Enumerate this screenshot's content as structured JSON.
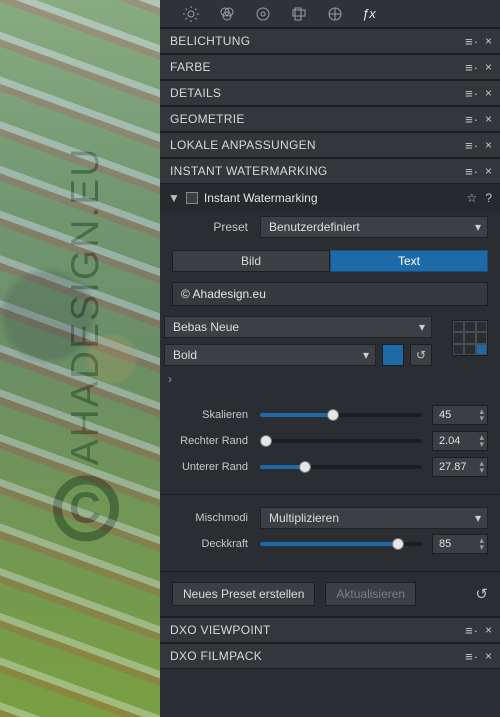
{
  "watermark_label": "AHADESIGN.EU",
  "tabs": [
    "brightness",
    "color-circles",
    "balance",
    "crop",
    "histogram",
    "fx"
  ],
  "sections": {
    "belichtung": "BELICHTUNG",
    "farbe": "FARBE",
    "details": "DETAILS",
    "geometrie": "GEOMETRIE",
    "lokal": "LOKALE ANPASSUNGEN",
    "watermark": "INSTANT WATERMARKING",
    "viewpoint": "DXO VIEWPOINT",
    "filmpack": "DXO FILMPACK"
  },
  "wm": {
    "title": "Instant Watermarking",
    "preset_label": "Preset",
    "preset_value": "Benutzerdefiniert",
    "bild": "Bild",
    "text": "Text",
    "input_value": "© Ahadesign.eu",
    "font": "Bebas Neue",
    "weight": "Bold",
    "swatch_color": "#1e6aa8",
    "skalieren_label": "Skalieren",
    "skalieren_value": "45",
    "rechter_label": "Rechter Rand",
    "rechter_value": "2.04",
    "unterer_label": "Unterer Rand",
    "unterer_value": "27.87",
    "mischmodi_label": "Mischmodi",
    "mischmodi_value": "Multiplizieren",
    "deckkraft_label": "Deckkraft",
    "deckkraft_value": "85",
    "neues_preset": "Neues Preset erstellen",
    "aktualisieren": "Aktualisieren"
  }
}
